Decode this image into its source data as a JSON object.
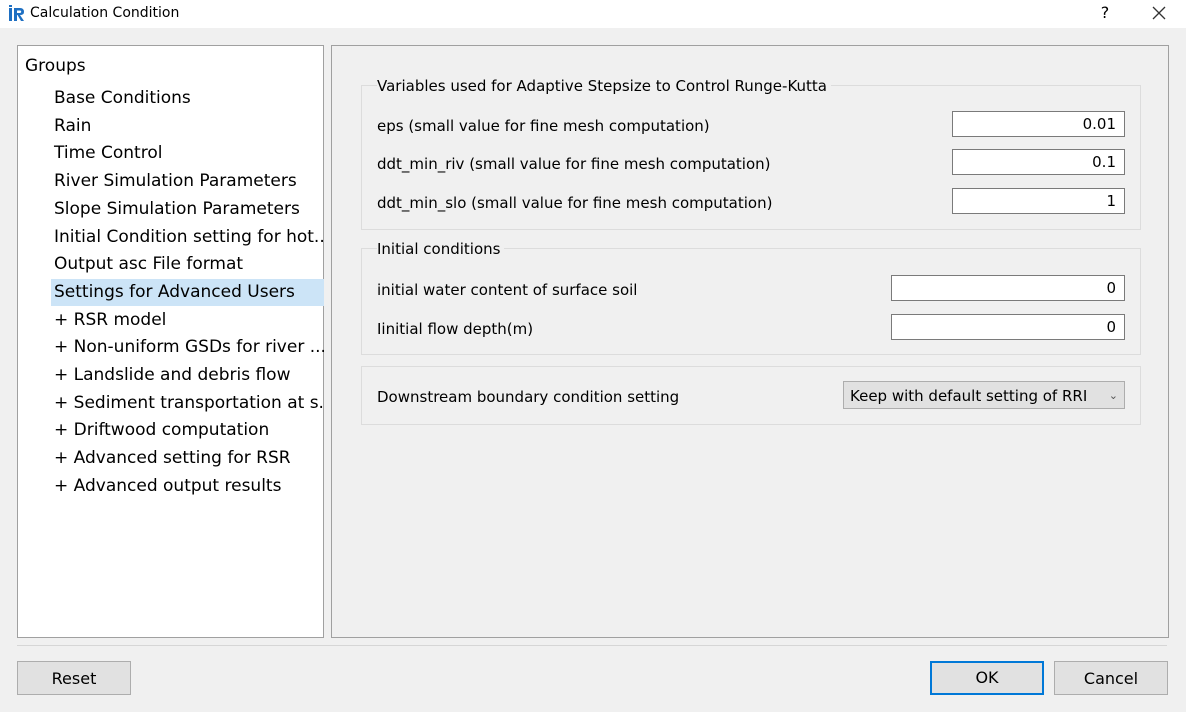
{
  "window": {
    "title": "Calculation Condition",
    "help_label": "?",
    "accent_color": "#0078d7",
    "selection_color": "#cce4f7"
  },
  "groups": {
    "header": "Groups",
    "items": [
      {
        "label": "Base Conditions"
      },
      {
        "label": "Rain"
      },
      {
        "label": "Time Control"
      },
      {
        "label": "River Simulation Parameters"
      },
      {
        "label": "Slope Simulation Parameters"
      },
      {
        "label": "Initial Condition setting for hot..."
      },
      {
        "label": "Output asc File format"
      },
      {
        "label": "Settings for Advanced Users",
        "selected": true
      },
      {
        "label": "+ RSR model"
      },
      {
        "label": "+ Non-uniform GSDs for river ..."
      },
      {
        "label": "+ Landslide and debris flow"
      },
      {
        "label": "+ Sediment transportation at s..."
      },
      {
        "label": "+ Driftwood computation"
      },
      {
        "label": "+ Advanced setting for RSR"
      },
      {
        "label": "+ Advanced output results"
      }
    ]
  },
  "adaptive": {
    "title": "Variables used for Adaptive Stepsize to Control Runge-Kutta",
    "eps_label": "eps (small value for fine mesh computation)",
    "eps_value": "0.01",
    "ddt_riv_label": "ddt_min_riv (small value for fine mesh computation)",
    "ddt_riv_value": "0.1",
    "ddt_slo_label": "ddt_min_slo (small value for fine mesh computation)",
    "ddt_slo_value": "1"
  },
  "initial": {
    "title": "Initial conditions",
    "water_label": "initial water content of surface soil",
    "water_value": "0",
    "depth_label": "Iinitial flow depth(m)",
    "depth_value": "0"
  },
  "downstream": {
    "label": "Downstream boundary condition setting",
    "selected": "Keep with default setting of RRI"
  },
  "buttons": {
    "reset": "Reset",
    "ok": "OK",
    "cancel": "Cancel"
  }
}
